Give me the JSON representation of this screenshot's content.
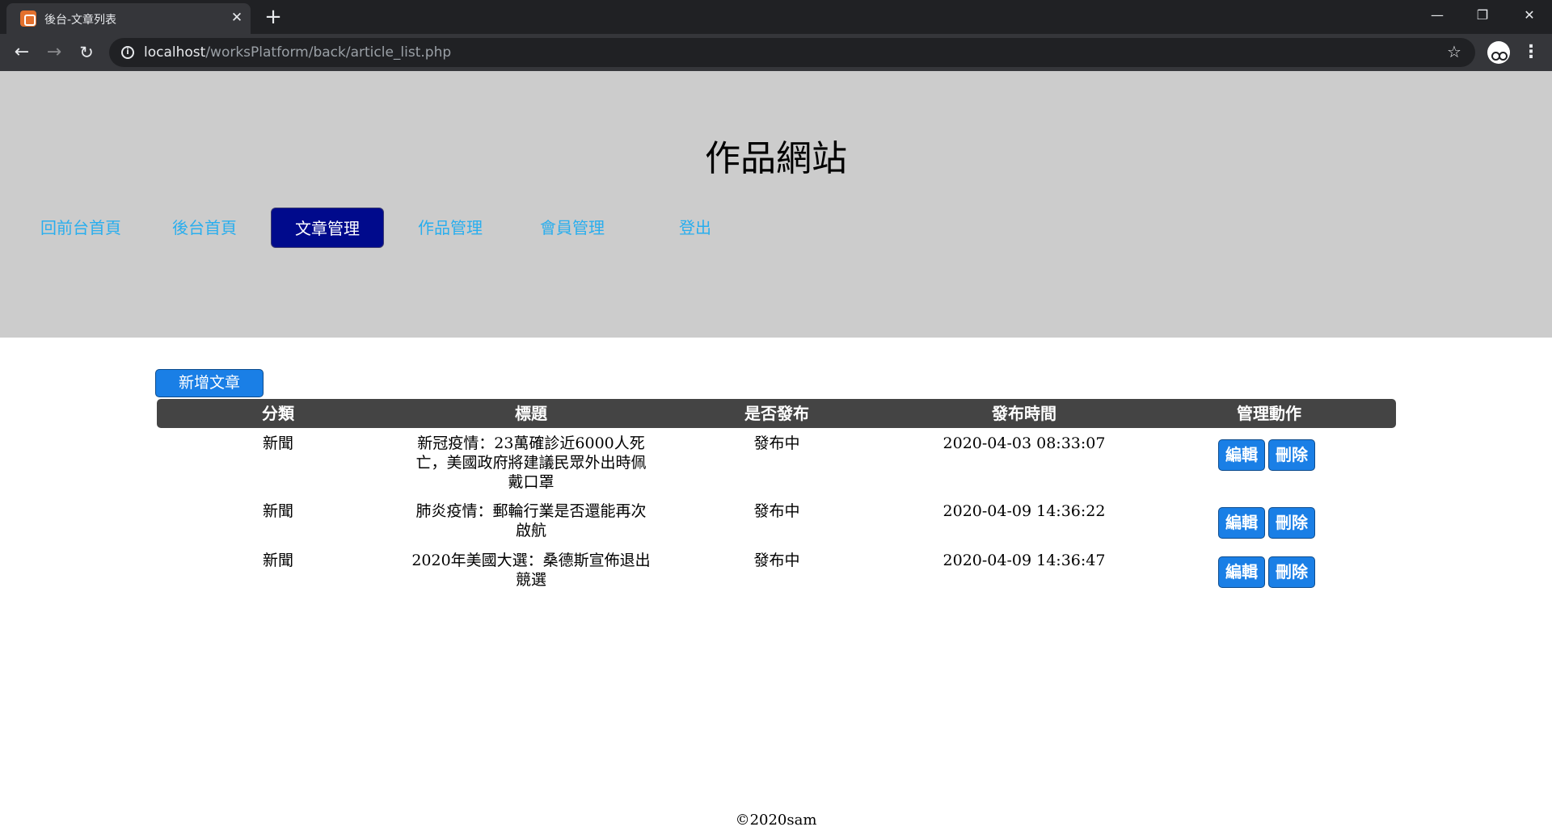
{
  "browser": {
    "tab_title": "後台-文章列表",
    "url_host": "localhost",
    "url_path": "/worksPlatform/back/article_list.php"
  },
  "site": {
    "title": "作品網站",
    "nav": [
      {
        "label": "回前台首頁"
      },
      {
        "label": "後台首頁"
      },
      {
        "label": "文章管理",
        "active": true
      },
      {
        "label": "作品管理"
      },
      {
        "label": "會員管理"
      },
      {
        "label": "登出"
      }
    ]
  },
  "articles": {
    "add_label": "新增文章",
    "headers": [
      "分類",
      "標題",
      "是否發布",
      "發布時間",
      "管理動作"
    ],
    "rows": [
      {
        "category": "新聞",
        "title": "新冠疫情：23萬確診近6000人死亡，美國政府將建議民眾外出時佩戴口罩",
        "status": "發布中",
        "published": "2020-04-03 08:33:07",
        "edit_label": "編輯",
        "delete_label": "刪除"
      },
      {
        "category": "新聞",
        "title": "肺炎疫情：郵輪行業是否還能再次啟航",
        "status": "發布中",
        "published": "2020-04-09 14:36:22",
        "edit_label": "編輯",
        "delete_label": "刪除"
      },
      {
        "category": "新聞",
        "title": "2020年美國大選：桑德斯宣佈退出競選",
        "status": "發布中",
        "published": "2020-04-09 14:36:47",
        "edit_label": "編輯",
        "delete_label": "刪除"
      }
    ]
  },
  "footer": {
    "text": "©2020sam"
  },
  "colors": {
    "header_bg": "#cccccc",
    "nav_link": "#29aeee",
    "nav_active_bg": "#000a8c",
    "button_bg": "#1a7fe6",
    "table_head_bg": "#444444"
  }
}
